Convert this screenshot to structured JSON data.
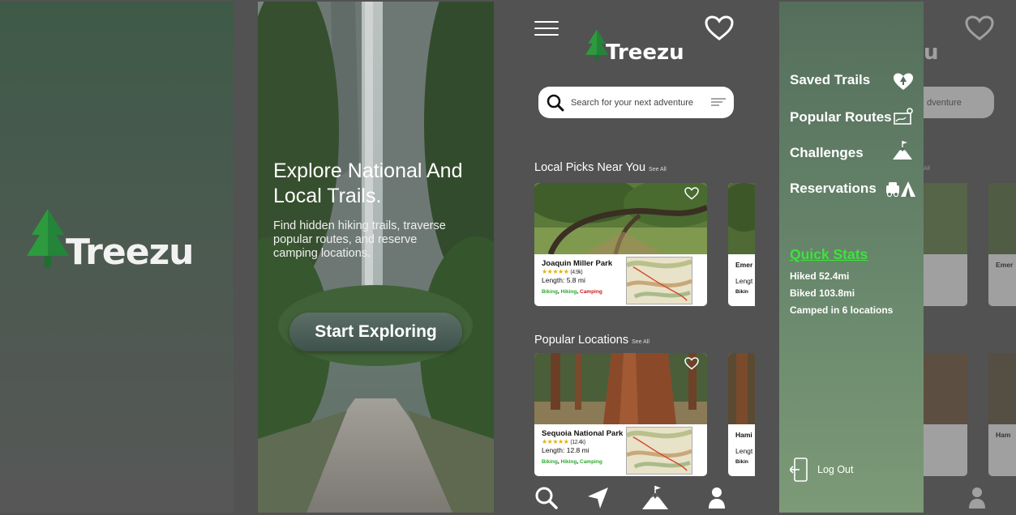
{
  "brand": {
    "name": "Treezu"
  },
  "splash": {
    "logo_text": "Treezu"
  },
  "hero": {
    "title": "Explore National And Local Trails.",
    "subtitle": "Find hidden hiking trails, traverse popular routes, and reserve camping locations.",
    "cta_label": "Start Exploring"
  },
  "home": {
    "logo_text": "Treezu",
    "search": {
      "placeholder": "Search for your next adventure"
    },
    "sections": [
      {
        "title": "Local Picks Near You",
        "see_all": "See All",
        "cards": [
          {
            "name": "Joaquin Miller Park",
            "stars": "★★★★★",
            "reviews": "(4.9k)",
            "length": "Length: 5.8 mi",
            "tags": [
              {
                "text": "Biking",
                "color": "green"
              },
              {
                "text": "Hiking",
                "color": "green"
              },
              {
                "text": "Camping",
                "color": "red"
              }
            ]
          },
          {
            "name_partial": "Emer",
            "length_partial": "Lengt",
            "tag_partial": "Bikin"
          }
        ]
      },
      {
        "title": "Popular Locations",
        "see_all": "See All",
        "cards": [
          {
            "name": "Sequoia National Park",
            "stars": "★★★★★",
            "reviews": "(12.4k)",
            "length": "Length: 12.8 mi",
            "tags": [
              {
                "text": "Biking",
                "color": "green"
              },
              {
                "text": "Hiking",
                "color": "green"
              },
              {
                "text": "Camping",
                "color": "green"
              }
            ]
          },
          {
            "name_partial": "Hami",
            "length_partial": "Lengt",
            "tag_partial": "Bikin"
          }
        ]
      }
    ],
    "bottom_nav": [
      "search-icon",
      "navigate-icon",
      "mountain-flag-icon",
      "profile-icon"
    ]
  },
  "drawer": {
    "items": [
      {
        "label": "Saved Trails",
        "icon": "heart-tree-icon"
      },
      {
        "label": "Popular Routes",
        "icon": "route-map-icon"
      },
      {
        "label": "Challenges",
        "icon": "mountain-flag-icon"
      },
      {
        "label": "Reservations",
        "icon": "car-tent-icon"
      }
    ],
    "quick_stats": {
      "title": "Quick Stats",
      "lines": [
        "Hiked 52.4mi",
        "Biked 103.8mi",
        "Camped in 6 locations"
      ]
    },
    "logout_label": "Log Out",
    "behind": {
      "logo_partial": "u",
      "search_partial": "dventure",
      "see_all_partial": "All",
      "card_partial_1": "Emer",
      "card_partial_2": "Ham"
    }
  },
  "colors": {
    "accent_green": "#3ee23e",
    "star": "#e2b200",
    "tag_green": "#2cab2c",
    "tag_red": "#c61c1c"
  }
}
